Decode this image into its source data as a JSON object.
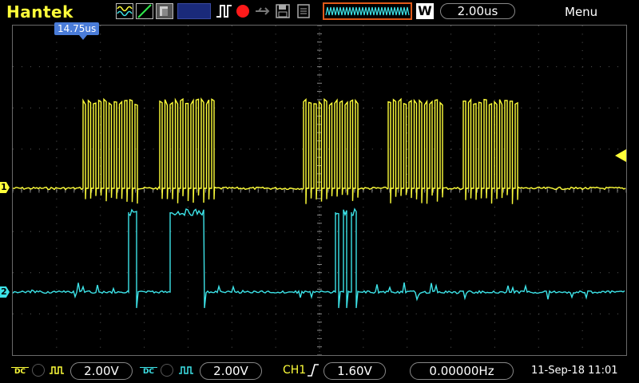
{
  "header": {
    "brand": "Hantek",
    "timebase": "2.00us",
    "timebase_mode": "W",
    "menu_label": "Menu"
  },
  "trigger_position": "14.75us",
  "channels": {
    "ch1": {
      "marker": "1",
      "color": "#ffff3a",
      "volts_div": "2.00V",
      "coupling": "DC"
    },
    "ch2": {
      "marker": "2",
      "color": "#3de3e8",
      "volts_div": "2.00V",
      "coupling": "DC"
    }
  },
  "trigger": {
    "source": "CH1",
    "level": "1.60V",
    "frequency": "0.00000Hz"
  },
  "datetime": "11-Sep-18 11:01",
  "colors": {
    "grid": "#5a5a5a",
    "accent_orange": "#e05a1a",
    "trigger_tag": "#4a7cd8"
  }
}
